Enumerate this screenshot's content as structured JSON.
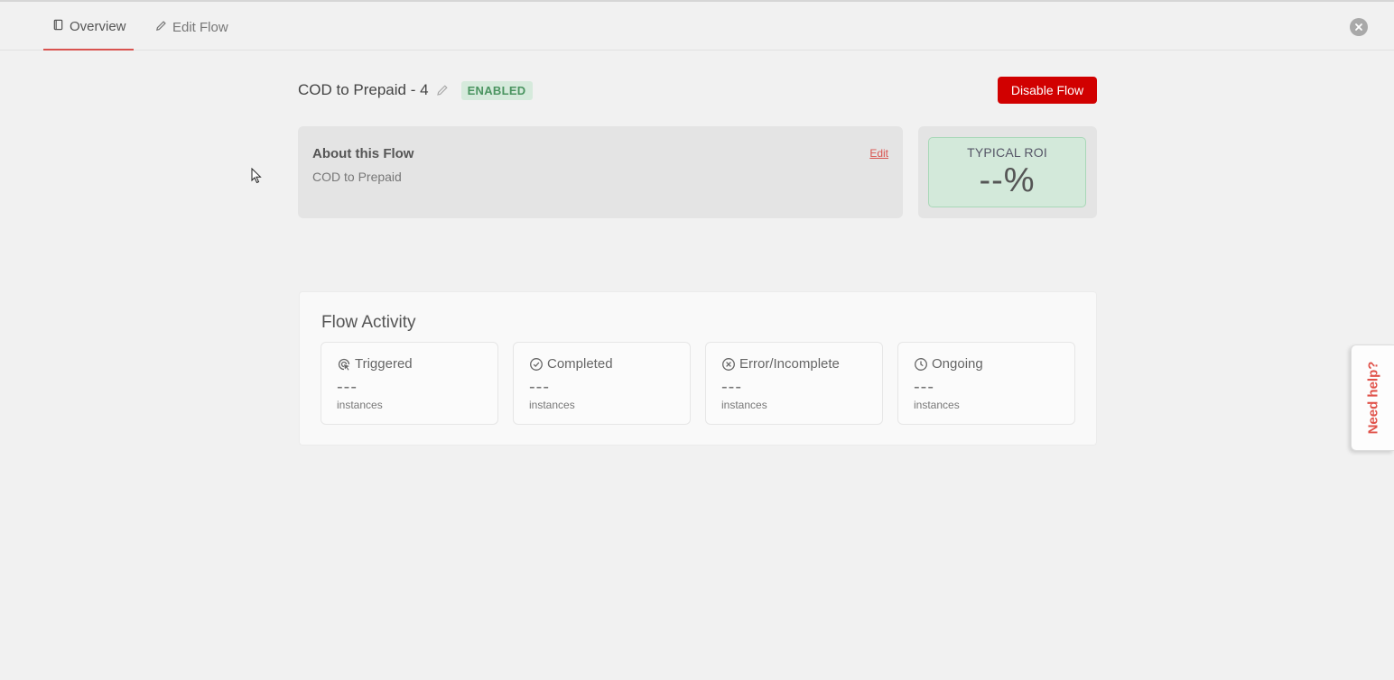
{
  "tabs": [
    {
      "label": "Overview",
      "icon": "book-icon",
      "active": true
    },
    {
      "label": "Edit Flow",
      "icon": "pencil-icon",
      "active": false
    }
  ],
  "flow": {
    "title": "COD to Prepaid - 4",
    "status": "ENABLED",
    "disable_label": "Disable Flow"
  },
  "about": {
    "title": "About this Flow",
    "description": "COD to Prepaid",
    "edit_label": "Edit"
  },
  "roi": {
    "label": "TYPICAL ROI",
    "value": "--%"
  },
  "activity": {
    "title": "Flow Activity",
    "stats": [
      {
        "label": "Triggered",
        "icon": "triggered-icon",
        "value": "---",
        "unit": "instances"
      },
      {
        "label": "Completed",
        "icon": "check-circle-icon",
        "value": "---",
        "unit": "instances"
      },
      {
        "label": "Error/Incomplete",
        "icon": "x-circle-icon",
        "value": "---",
        "unit": "instances"
      },
      {
        "label": "Ongoing",
        "icon": "clock-icon",
        "value": "---",
        "unit": "instances"
      }
    ]
  },
  "help": {
    "label": "Need help?"
  },
  "colors": {
    "accent_red": "#d10000",
    "enabled_bg": "#d6eadc",
    "enabled_text": "#4a9460",
    "roi_bg": "#d3e9da",
    "help_text": "#e0524a"
  }
}
